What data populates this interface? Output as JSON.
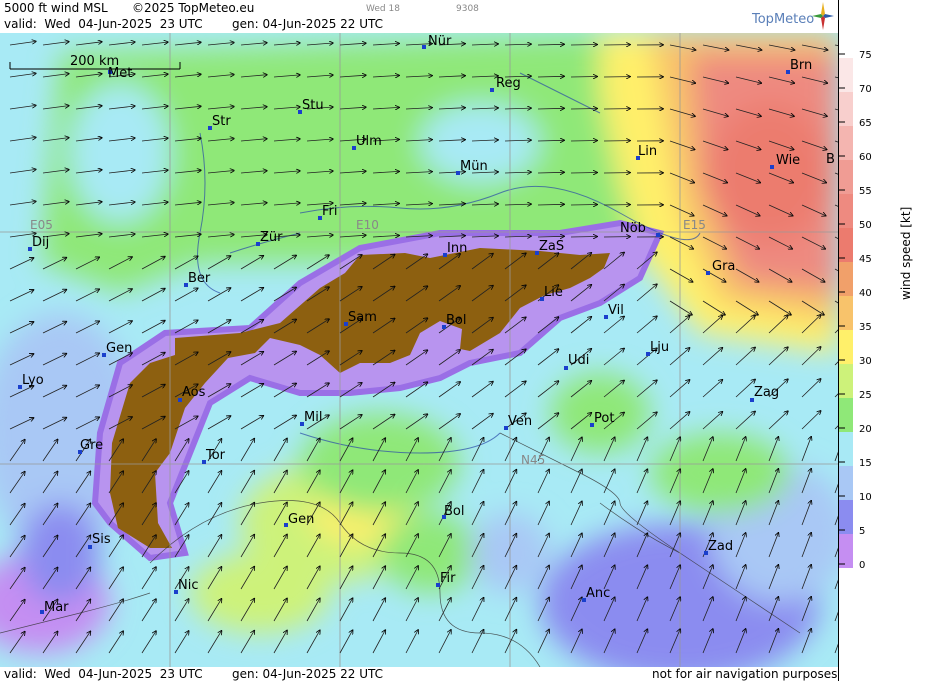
{
  "header": {
    "product": "5000 ft wind MSL",
    "copyright": "©2025 TopMeteo.eu",
    "valid": "valid:  Wed  04-Jun-2025  23 UTC",
    "generated": "gen: 04-Jun-2025 22 UTC",
    "faint_day": "Wed 18",
    "faint_code": "9308",
    "logo": "TopMeteo"
  },
  "footer": {
    "valid": "valid:  Wed  04-Jun-2025  23 UTC",
    "generated": "gen: 04-Jun-2025 22 UTC",
    "disclaimer": "not for air navigation purposes"
  },
  "scale_bar": {
    "label": "200 km"
  },
  "grid_labels": [
    "E05",
    "E10",
    "E15",
    "N45"
  ],
  "cities": [
    "Nür",
    "Reg",
    "Brn",
    "Met",
    "Str",
    "Stu",
    "Ulm",
    "Mün",
    "Lin",
    "Wie",
    "B",
    "Fri",
    "Dij",
    "Zür",
    "Inn",
    "ZaS",
    "Nöb",
    "Gra",
    "Ber",
    "Lie",
    "Vil",
    "Sam",
    "Bol",
    "Gen",
    "Lju",
    "Lyo",
    "Udi",
    "Aos",
    "Zag",
    "Mil",
    "Ven",
    "Pot",
    "Gre",
    "Tor",
    "Gen",
    "Bol",
    "Zad",
    "Sis",
    "Nic",
    "Fir",
    "Anc",
    "Mar"
  ],
  "legend": {
    "title": "wind speed [kt]",
    "ticks": [
      "75",
      "70",
      "65",
      "60",
      "55",
      "50",
      "45",
      "40",
      "35",
      "30",
      "25",
      "20",
      "15",
      "10",
      "5",
      "0"
    ],
    "colors": [
      "#ffffff",
      "#fbe7e7",
      "#f8cfcd",
      "#f4b5b0",
      "#f09c94",
      "#ee8a80",
      "#ec7b6e",
      "#f1a06a",
      "#f8c36b",
      "#fff06a",
      "#cdf27a",
      "#8fe878",
      "#a8e9f5",
      "#a9c8f5",
      "#8b8cf0",
      "#c58ef2"
    ]
  }
}
